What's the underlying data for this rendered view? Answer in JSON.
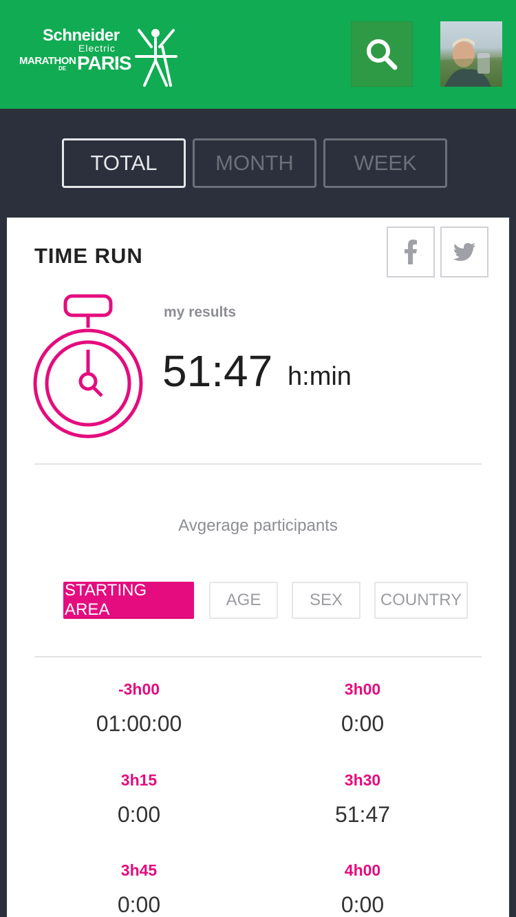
{
  "header": {
    "logo": {
      "line1": "Schneider",
      "line2": "Electric",
      "line3": "MARATHON",
      "line4": "DE",
      "line5": "PARIS"
    },
    "search_icon": "search-icon",
    "avatar": "user-avatar"
  },
  "tabs": [
    {
      "label": "TOTAL",
      "active": true
    },
    {
      "label": "MONTH",
      "active": false
    },
    {
      "label": "WEEK",
      "active": false
    }
  ],
  "card": {
    "title": "TIME RUN",
    "share": [
      "facebook-icon",
      "twitter-icon"
    ],
    "results_label": "my results",
    "results_value": "51:47",
    "results_unit": "h:min",
    "average_label": "Avgerage participants",
    "filters": [
      {
        "label": "STARTING AREA",
        "active": true
      },
      {
        "label": "AGE",
        "active": false
      },
      {
        "label": "SEX",
        "active": false
      },
      {
        "label": "COUNTRY",
        "active": false
      }
    ],
    "grid": [
      {
        "key": "-3h00",
        "value": "01:00:00"
      },
      {
        "key": "3h00",
        "value": "0:00"
      },
      {
        "key": "3h15",
        "value": "0:00"
      },
      {
        "key": "3h30",
        "value": "51:47"
      },
      {
        "key": "3h45",
        "value": "0:00"
      },
      {
        "key": "4h00",
        "value": "0:00"
      }
    ]
  },
  "colors": {
    "brand_green": "#11ab53",
    "accent_pink": "#e40c7e",
    "dark_bg": "#2b303c"
  }
}
